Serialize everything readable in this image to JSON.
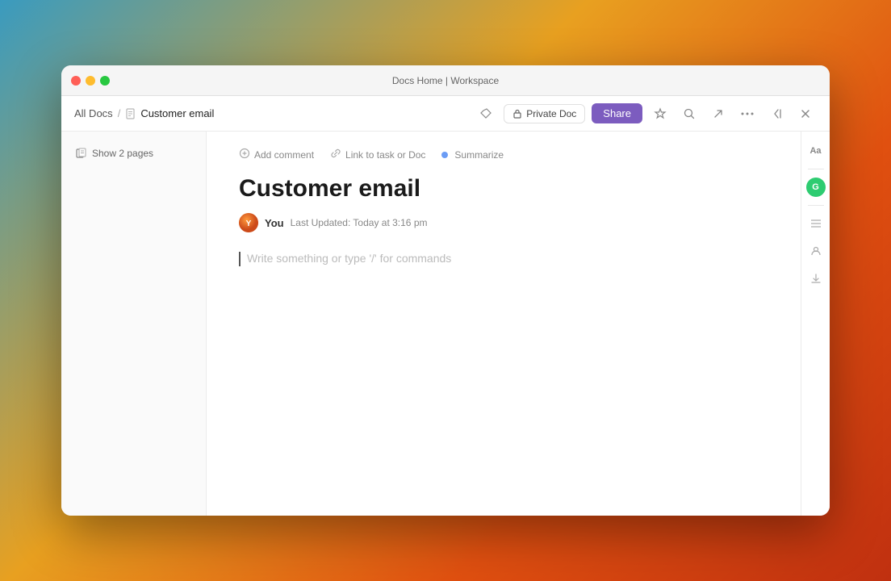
{
  "window": {
    "title": "Docs Home | Workspace",
    "traffic_lights": {
      "close": "close",
      "minimize": "minimize",
      "maximize": "maximize"
    }
  },
  "toolbar": {
    "breadcrumb": {
      "all_docs_label": "All Docs",
      "separator": "/",
      "current_label": "Customer email",
      "doc_icon": "📄"
    },
    "actions": {
      "lock_icon": "🔒",
      "private_label": "Private Doc",
      "share_label": "Share",
      "star_icon": "☆",
      "search_icon": "⌕",
      "export_icon": "↗",
      "more_icon": "···",
      "collapse_icon": "⇥",
      "close_icon": "✕"
    }
  },
  "sidebar": {
    "show_pages_label": "Show 2 pages",
    "pages_icon": "⊞"
  },
  "editor": {
    "action_bar": {
      "add_comment_label": "Add comment",
      "link_task_label": "Link to task or Doc",
      "summarize_label": "Summarize"
    },
    "title": "Customer email",
    "author": {
      "name": "You",
      "avatar_initials": "Y"
    },
    "last_updated": "Last Updated: Today at 3:16 pm",
    "placeholder": "Write something or type '/' for commands"
  },
  "right_sidebar": {
    "format_icon": "Aa",
    "indent_icon": "⇥",
    "people_icon": "👤",
    "download_icon": "↓"
  },
  "presence": {
    "indicator": "G",
    "color": "#2ecc71"
  },
  "colors": {
    "share_btn_bg": "#7c5cbf",
    "window_bg": "#ffffff",
    "title_bar_bg": "#f5f5f5"
  }
}
